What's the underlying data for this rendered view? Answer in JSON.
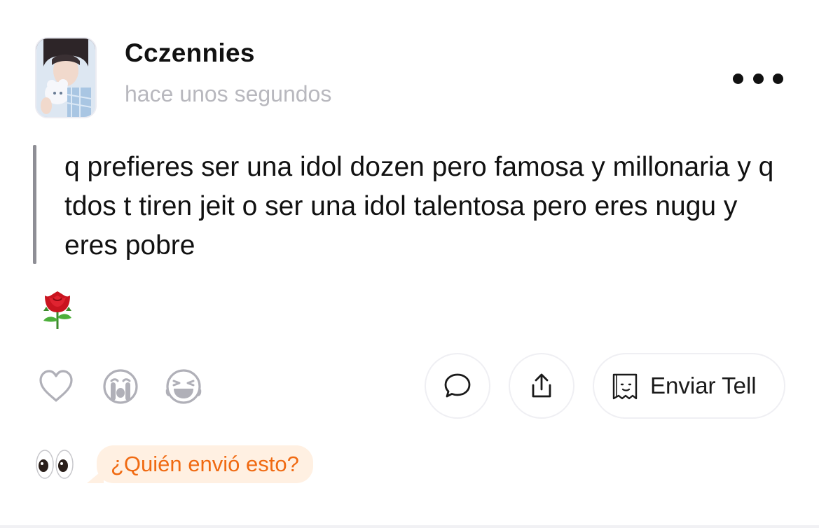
{
  "post": {
    "username": "Cczennies",
    "timestamp": "hace unos segundos",
    "question": "q prefieres ser una idol dozen pero famosa y millonaria y q tdos t tiren jeit o ser una idol talentosa pero eres nugu y eres pobre",
    "answer_emoji": "rose"
  },
  "actions": {
    "like_icon": "heart-outline-icon",
    "cry_icon": "crying-face-icon",
    "laugh_icon": "laughing-face-icon",
    "comment_icon": "speech-bubble-icon",
    "share_icon": "share-icon",
    "send_tell_icon": "tell-note-icon",
    "send_tell_label": "Enviar Tell"
  },
  "footer": {
    "eyes_icon": "eyes-icon",
    "who_sent_label": "¿Quién envió esto?"
  },
  "colors": {
    "accent_orange": "#f06a12",
    "bubble_bg": "#fff0e2",
    "muted_text": "#b8b8be",
    "icon_gray": "#b0b0b8"
  }
}
